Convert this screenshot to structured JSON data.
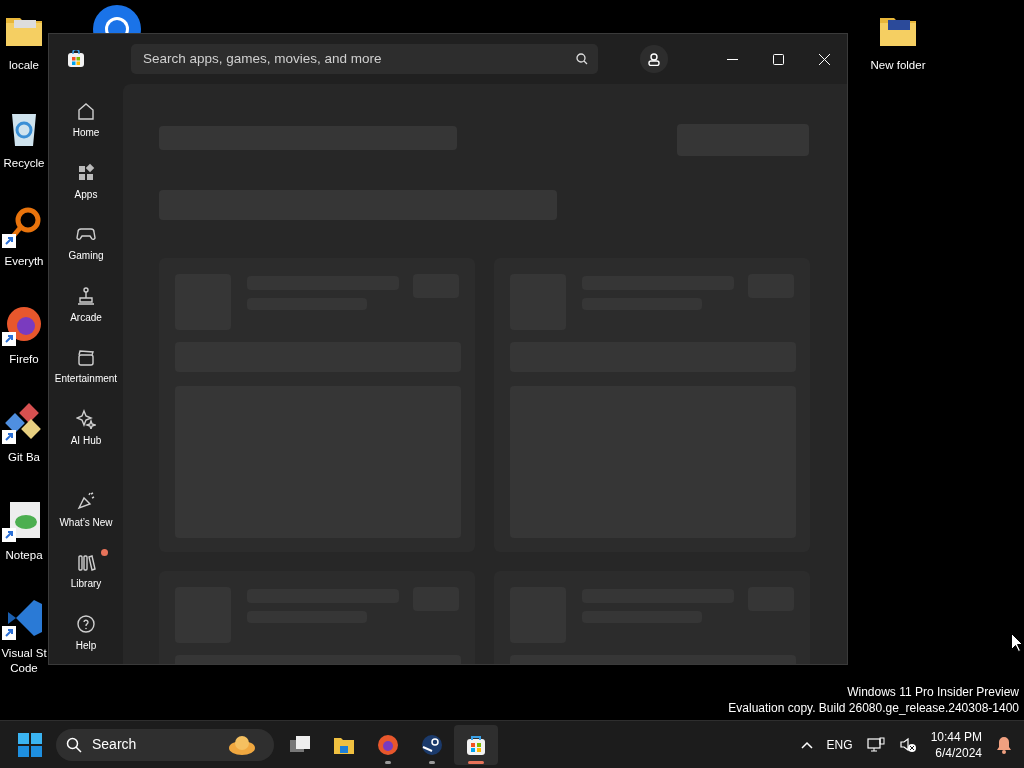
{
  "desktop": {
    "icons": [
      {
        "label": "locale",
        "shortcut": false
      },
      {
        "label": "Recycle",
        "shortcut": false
      },
      {
        "label": "Everyth",
        "shortcut": true
      },
      {
        "label": "Firefo",
        "shortcut": true
      },
      {
        "label": "Git Ba",
        "shortcut": true
      },
      {
        "label": "Notepa",
        "shortcut": true
      },
      {
        "label": "Visual St\nCode",
        "shortcut": true
      }
    ],
    "right_icons": [
      {
        "label": "New folder",
        "shortcut": false
      }
    ],
    "watermark": [
      "Windows 11 Pro Insider Preview",
      "Evaluation copy. Build 26080.ge_release.240308-1400"
    ]
  },
  "window": {
    "search": {
      "placeholder": "Search apps, games, movies, and more"
    },
    "sidebar": {
      "items": [
        {
          "label": "Home",
          "notification": false
        },
        {
          "label": "Apps",
          "notification": false
        },
        {
          "label": "Gaming",
          "notification": false
        },
        {
          "label": "Arcade",
          "notification": false
        },
        {
          "label": "Entertainment",
          "notification": false
        },
        {
          "label": "AI Hub",
          "notification": false
        }
      ],
      "footer_items": [
        {
          "label": "What’s New",
          "notification": false
        },
        {
          "label": "Library",
          "notification": true
        },
        {
          "label": "Help",
          "notification": false
        }
      ]
    }
  },
  "taskbar": {
    "search": {
      "placeholder": "Search"
    },
    "apps": [
      {
        "running": false,
        "active": false
      },
      {
        "running": false,
        "active": false
      },
      {
        "running": true,
        "active": false
      },
      {
        "running": true,
        "active": false
      },
      {
        "running": true,
        "active": true
      }
    ],
    "tray": {
      "language": "ENG",
      "time": "10:44 PM",
      "date": "6/4/2024"
    }
  }
}
